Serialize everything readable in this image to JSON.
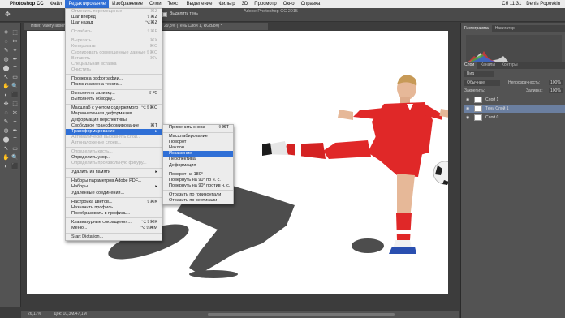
{
  "menubar": {
    "apple": "",
    "items": [
      "Photoshop CC",
      "Файл",
      "Редактирование",
      "Изображение",
      "Слои",
      "Текст",
      "Выделение",
      "Фильтр",
      "3D",
      "Просмотр",
      "Окно",
      "Справка"
    ],
    "active_index": 2,
    "clock": "Сб 11:31",
    "user": "Denis Popovkin"
  },
  "window_title": "Adobe Photoshop CC 2015",
  "options": {
    "checkbox_label": "Выделить тень"
  },
  "doc_tab": "Hitler, Valery Iatsenko @ 66,7% (Тень Слой 1, RGB/8#) *",
  "doc_tab_right": "29,3% (Тень Слой 1, RGB/8#) *",
  "status": {
    "zoom": "26,17%",
    "doc": "Док: 10,3M/47,1M"
  },
  "edit_menu": [
    {
      "label": "Отменить перемещение",
      "shortcut": "⌘Z",
      "disabled": true
    },
    {
      "label": "Шаг вперед",
      "shortcut": "⇧⌘Z",
      "disabled": false
    },
    {
      "label": "Шаг назад",
      "shortcut": "⌥⌘Z",
      "disabled": false
    },
    {
      "sep": true
    },
    {
      "label": "Ослабить...",
      "shortcut": "⇧⌘F",
      "disabled": true
    },
    {
      "sep": true
    },
    {
      "label": "Вырезать",
      "shortcut": "⌘X",
      "disabled": true
    },
    {
      "label": "Копировать",
      "shortcut": "⌘C",
      "disabled": true
    },
    {
      "label": "Скопировать совмещенные данные",
      "shortcut": "⇧⌘C",
      "disabled": true
    },
    {
      "label": "Вставить",
      "shortcut": "⌘V",
      "disabled": true
    },
    {
      "label": "Специальная вставка",
      "shortcut": "",
      "disabled": true
    },
    {
      "label": "Очистить",
      "shortcut": "",
      "disabled": true
    },
    {
      "sep": true
    },
    {
      "label": "Проверка орфографии...",
      "shortcut": "",
      "disabled": false
    },
    {
      "label": "Поиск и замена текста...",
      "shortcut": "",
      "disabled": false
    },
    {
      "sep": true
    },
    {
      "label": "Выполнить заливку...",
      "shortcut": "⇧F5",
      "disabled": false
    },
    {
      "label": "Выполнить обводку...",
      "shortcut": "",
      "disabled": false
    },
    {
      "sep": true
    },
    {
      "label": "Масштаб с учетом содержимого",
      "shortcut": "⌥⇧⌘C",
      "disabled": false
    },
    {
      "label": "Марионеточная деформация",
      "shortcut": "",
      "disabled": false
    },
    {
      "label": "Деформация перспективы",
      "shortcut": "",
      "disabled": false
    },
    {
      "label": "Свободное трансформирование",
      "shortcut": "⌘T",
      "disabled": false
    },
    {
      "label": "Трансформирование",
      "shortcut": "▸",
      "disabled": false,
      "highlight": true
    },
    {
      "label": "Автоматически выровнять слои...",
      "shortcut": "",
      "disabled": true
    },
    {
      "label": "Автоналожение слоев...",
      "shortcut": "",
      "disabled": true
    },
    {
      "sep": true
    },
    {
      "label": "Определить кисть...",
      "shortcut": "",
      "disabled": true
    },
    {
      "label": "Определить узор...",
      "shortcut": "",
      "disabled": false
    },
    {
      "label": "Определить произвольную фигуру...",
      "shortcut": "",
      "disabled": true
    },
    {
      "sep": true
    },
    {
      "label": "Удалить из памяти",
      "shortcut": "▸",
      "disabled": false
    },
    {
      "sep": true
    },
    {
      "label": "Наборы параметров Adobe PDF...",
      "shortcut": "",
      "disabled": false
    },
    {
      "label": "Наборы",
      "shortcut": "▸",
      "disabled": false
    },
    {
      "label": "Удаленные соединения...",
      "shortcut": "",
      "disabled": false
    },
    {
      "sep": true
    },
    {
      "label": "Настройка цветов...",
      "shortcut": "⇧⌘K",
      "disabled": false
    },
    {
      "label": "Назначить профиль...",
      "shortcut": "",
      "disabled": false
    },
    {
      "label": "Преобразовать в профиль...",
      "shortcut": "",
      "disabled": false
    },
    {
      "sep": true
    },
    {
      "label": "Клавиатурные сокращения...",
      "shortcut": "⌥⇧⌘K",
      "disabled": false
    },
    {
      "label": "Меню...",
      "shortcut": "⌥⇧⌘M",
      "disabled": false
    },
    {
      "sep": true
    },
    {
      "label": "Start Dictation...",
      "shortcut": "",
      "disabled": false
    }
  ],
  "transform_menu": [
    {
      "label": "Применить снова",
      "shortcut": "⇧⌘T"
    },
    {
      "sep": true
    },
    {
      "label": "Масштабирование",
      "shortcut": ""
    },
    {
      "label": "Поворот",
      "shortcut": ""
    },
    {
      "label": "Наклон",
      "shortcut": ""
    },
    {
      "label": "Искажение",
      "shortcut": "",
      "highlight": true
    },
    {
      "label": "Перспектива",
      "shortcut": ""
    },
    {
      "label": "Деформация",
      "shortcut": ""
    },
    {
      "sep": true
    },
    {
      "label": "Поворот на 180°",
      "shortcut": ""
    },
    {
      "label": "Повернуть на 90° по ч. с.",
      "shortcut": ""
    },
    {
      "label": "Повернуть на 90° против ч. с.",
      "shortcut": ""
    },
    {
      "sep": true
    },
    {
      "label": "Отразить по горизонтали",
      "shortcut": ""
    },
    {
      "label": "Отразить по вертикали",
      "shortcut": ""
    }
  ],
  "panels": {
    "top_tabs": [
      "Гистограмма",
      "Навигатор"
    ],
    "layer_tabs": [
      "Слои",
      "Каналы",
      "Контуры"
    ],
    "kind_label": "Вид",
    "blend": "Обычные",
    "opacity_label": "Непрозрачность:",
    "opacity": "100%",
    "lock_label": "Закрепить:",
    "fill_label": "Заливка:",
    "fill": "100%",
    "layers": [
      {
        "name": "Слой 1",
        "selected": false
      },
      {
        "name": "Тень Слой 1",
        "selected": true
      },
      {
        "name": "Слой 0",
        "selected": false
      }
    ]
  }
}
